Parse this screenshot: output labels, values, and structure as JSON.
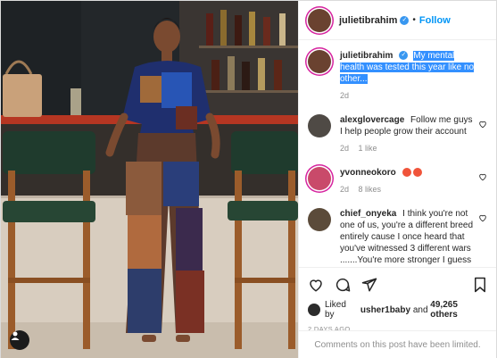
{
  "header": {
    "username": "julietibrahim",
    "separator": "•",
    "follow_label": "Follow"
  },
  "comments": [
    {
      "username": "julietibrahim",
      "text": "My mental health was tested this year like no other...",
      "time": "2d",
      "selected": true
    },
    {
      "username": "alexglovercage",
      "text": "Follow me guys I help people grow their account",
      "time": "2d",
      "likes": "1 like",
      "reply": ""
    },
    {
      "username": "yvonneokoro",
      "text": "",
      "emoji_count": 2,
      "time": "2d",
      "likes": "8 likes"
    },
    {
      "username": "chief_onyeka",
      "text": "I think you're not one of us, you're a different breed entirely cause I once heard that you've witnessed 3 different wars .......You're more stronger I guess"
    }
  ],
  "actions": {
    "liked_prefix": "Liked by",
    "liked_user": "usher1baby",
    "liked_and": "and",
    "liked_others": "49,265 others",
    "time_ago": "2 DAYS AGO"
  },
  "footer": {
    "limited_text": "Comments on this post have been limited."
  },
  "colors": {
    "accent_blue": "#0095f6",
    "verified_blue": "#3897f0",
    "selection": "#3390ff",
    "muted": "#8e8e8e"
  },
  "icons": [
    "user-tag-icon",
    "verified-icon",
    "heart-icon",
    "comment-icon",
    "share-icon",
    "bookmark-icon"
  ]
}
